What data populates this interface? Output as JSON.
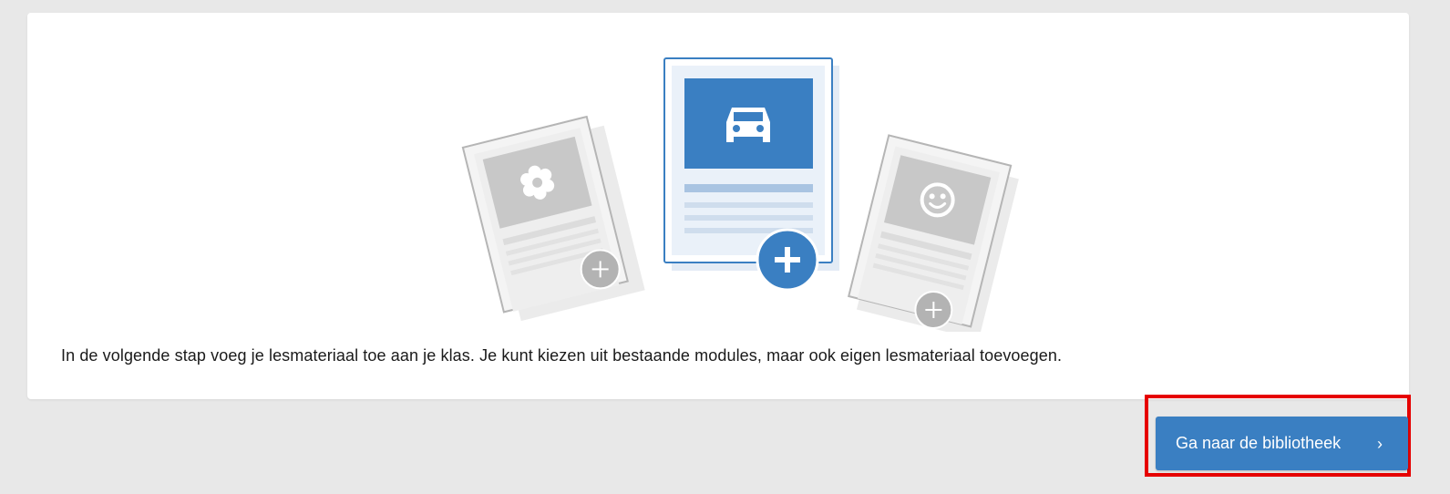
{
  "card": {
    "description": "In de volgende stap voeg je lesmateriaal toe aan je klas. Je kunt kiezen uit bestaande modules, maar ook eigen lesmateriaal toevoegen."
  },
  "illustration": {
    "icons": [
      "flower-icon",
      "car-icon",
      "smiley-icon",
      "plus-icon"
    ],
    "colors": {
      "primary": "#3a7fc2",
      "primary_light": "#eaf1f9",
      "grey_doc": "#f2f2f2",
      "grey_image": "#c8c8c8",
      "grey_plus": "#b3b3b3"
    }
  },
  "footer": {
    "button_label": "Ga naar de bibliotheek",
    "button_icon": "chevron-right-icon"
  },
  "colors": {
    "page_bg": "#e8e8e8",
    "card_bg": "#ffffff",
    "button_bg": "#3a7fc2",
    "highlight": "#e60000"
  }
}
